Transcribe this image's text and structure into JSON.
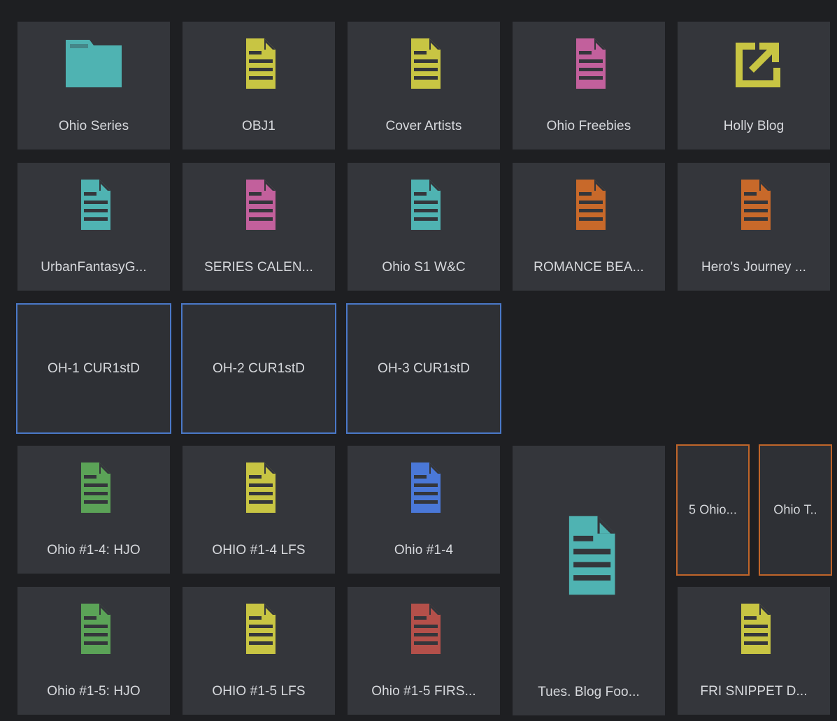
{
  "colors": {
    "teal": "#4fb3b2",
    "yellow": "#c8c543",
    "pink": "#c2609c",
    "orange": "#c8692a",
    "green": "#5ba357",
    "blue": "#4a78d8",
    "red": "#b4504a",
    "blue_outline": "#4a78c8",
    "orange_outline": "#c0652a"
  },
  "tiles": [
    {
      "label": "Ohio Series",
      "icon": "folder-icon",
      "color": "teal"
    },
    {
      "label": "OBJ1",
      "icon": "document-icon",
      "color": "yellow"
    },
    {
      "label": "Cover Artists",
      "icon": "document-icon",
      "color": "yellow"
    },
    {
      "label": "Ohio Freebies",
      "icon": "document-icon",
      "color": "pink"
    },
    {
      "label": "Holly Blog",
      "icon": "external-link-icon",
      "color": "yellow"
    },
    {
      "label": "UrbanFantasyG...",
      "icon": "document-icon",
      "color": "teal"
    },
    {
      "label": "SERIES CALEN...",
      "icon": "document-icon",
      "color": "pink"
    },
    {
      "label": "Ohio S1 W&C",
      "icon": "document-icon",
      "color": "teal"
    },
    {
      "label": "ROMANCE BEA...",
      "icon": "document-icon",
      "color": "orange"
    },
    {
      "label": "Hero's Journey ...",
      "icon": "document-icon",
      "color": "orange"
    },
    {
      "label": "OH-1 CUR1stD"
    },
    {
      "label": "OH-2 CUR1stD"
    },
    {
      "label": "OH-3 CUR1stD"
    },
    {
      "label": "Ohio #1-4: HJO",
      "icon": "document-icon",
      "color": "green"
    },
    {
      "label": "OHIO #1-4 LFS",
      "icon": "document-icon",
      "color": "yellow"
    },
    {
      "label": "Ohio #1-4",
      "icon": "document-icon",
      "color": "blue"
    },
    {
      "label": "Tues. Blog Foo...",
      "icon": "document-icon",
      "color": "teal"
    },
    {
      "label": "5 Ohio..."
    },
    {
      "label": "Ohio T.."
    },
    {
      "label": "Ohio #1-5: HJO",
      "icon": "document-icon",
      "color": "green"
    },
    {
      "label": "OHIO #1-5 LFS",
      "icon": "document-icon",
      "color": "yellow"
    },
    {
      "label": "Ohio #1-5 FIRS...",
      "icon": "document-icon",
      "color": "red"
    },
    {
      "label": "FRI SNIPPET D...",
      "icon": "document-icon",
      "color": "yellow"
    }
  ]
}
